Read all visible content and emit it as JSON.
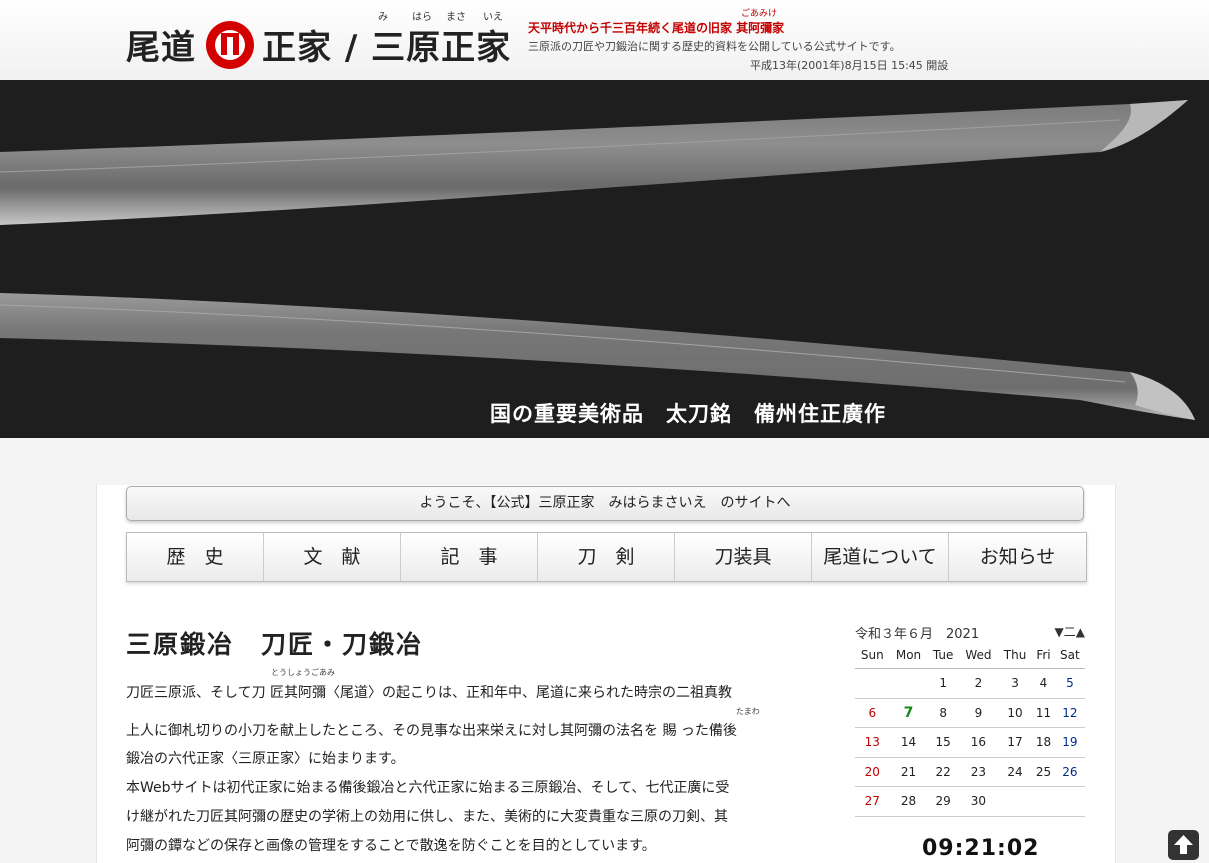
{
  "header": {
    "logo_left": "尾道",
    "logo_right": "正家 / 三原正家",
    "logo_ruby": [
      "み",
      "はら",
      "まさ",
      "いえ"
    ],
    "tagline": "天平時代から千三百年続く尾道の旧家 其阿彌家",
    "tagline_ruby": "ごあみけ",
    "description": "三原派の刀匠や刀鍛治に関する歴史的資料を公開している公式サイトです。",
    "founded": "平成13年(2001年)8月15日 15:45 開設",
    "crest_icon": "crest-icon"
  },
  "hero": {
    "caption": "国の重要美術品　太刀銘　備州住正廣作"
  },
  "welcome": "ようこそ、【公式】三原正家　みはらまさいえ　のサイトへ",
  "nav": {
    "items": [
      {
        "label": "歴　史"
      },
      {
        "label": "文　献"
      },
      {
        "label": "記　事"
      },
      {
        "label": "刀　剣"
      },
      {
        "label": "刀装具"
      },
      {
        "label": "尾道について"
      },
      {
        "label": "お知らせ"
      }
    ]
  },
  "article": {
    "title": "三原鍛冶　刀匠・刀鍛冶",
    "ruby_goami": "とうしょうごあみ",
    "ruby_tamawa": "たまわ",
    "lines": [
      "刀匠三原派、そして刀 匠其阿彌〈尾道〉の起こりは、正和年中、尾道に来られた時宗の二祖真教",
      "上人に御札切りの小刀を献上したところ、その見事な出来栄えに対し其阿彌の法名を 賜 った備後",
      "鍛冶の六代正家〈三原正家〉に始まります。",
      "本Webサイトは初代正家に始まる備後鍛冶と六代正家に始まる三原鍛冶、そして、七代正廣に受",
      "け継がれた刀匠其阿彌の歴史の学術上の効用に供し、また、美術的に大変貴重な三原の刀剣、其",
      "阿彌の鐔などの保存と画像の管理をすることで散逸を防ぐことを目的としています。"
    ]
  },
  "calendar": {
    "title": "令和３年６月　2021",
    "prev": "▼",
    "mode": "二",
    "next": "▲",
    "weekdays": [
      "Sun",
      "Mon",
      "Tue",
      "Wed",
      "Thu",
      "Fri",
      "Sat"
    ],
    "weeks": [
      [
        "",
        "",
        "1",
        "2",
        "3",
        "4",
        "5"
      ],
      [
        "6",
        "7",
        "8",
        "9",
        "10",
        "11",
        "12"
      ],
      [
        "13",
        "14",
        "15",
        "16",
        "17",
        "18",
        "19"
      ],
      [
        "20",
        "21",
        "22",
        "23",
        "24",
        "25",
        "26"
      ],
      [
        "27",
        "28",
        "29",
        "30",
        "",
        "",
        ""
      ]
    ],
    "today": "7",
    "colors": {
      "sunday": "#c00000",
      "saturday": "#002b8a",
      "today": "#118811"
    }
  },
  "clock": "09:21:02",
  "back_to_top_icon": "arrow-up-icon"
}
